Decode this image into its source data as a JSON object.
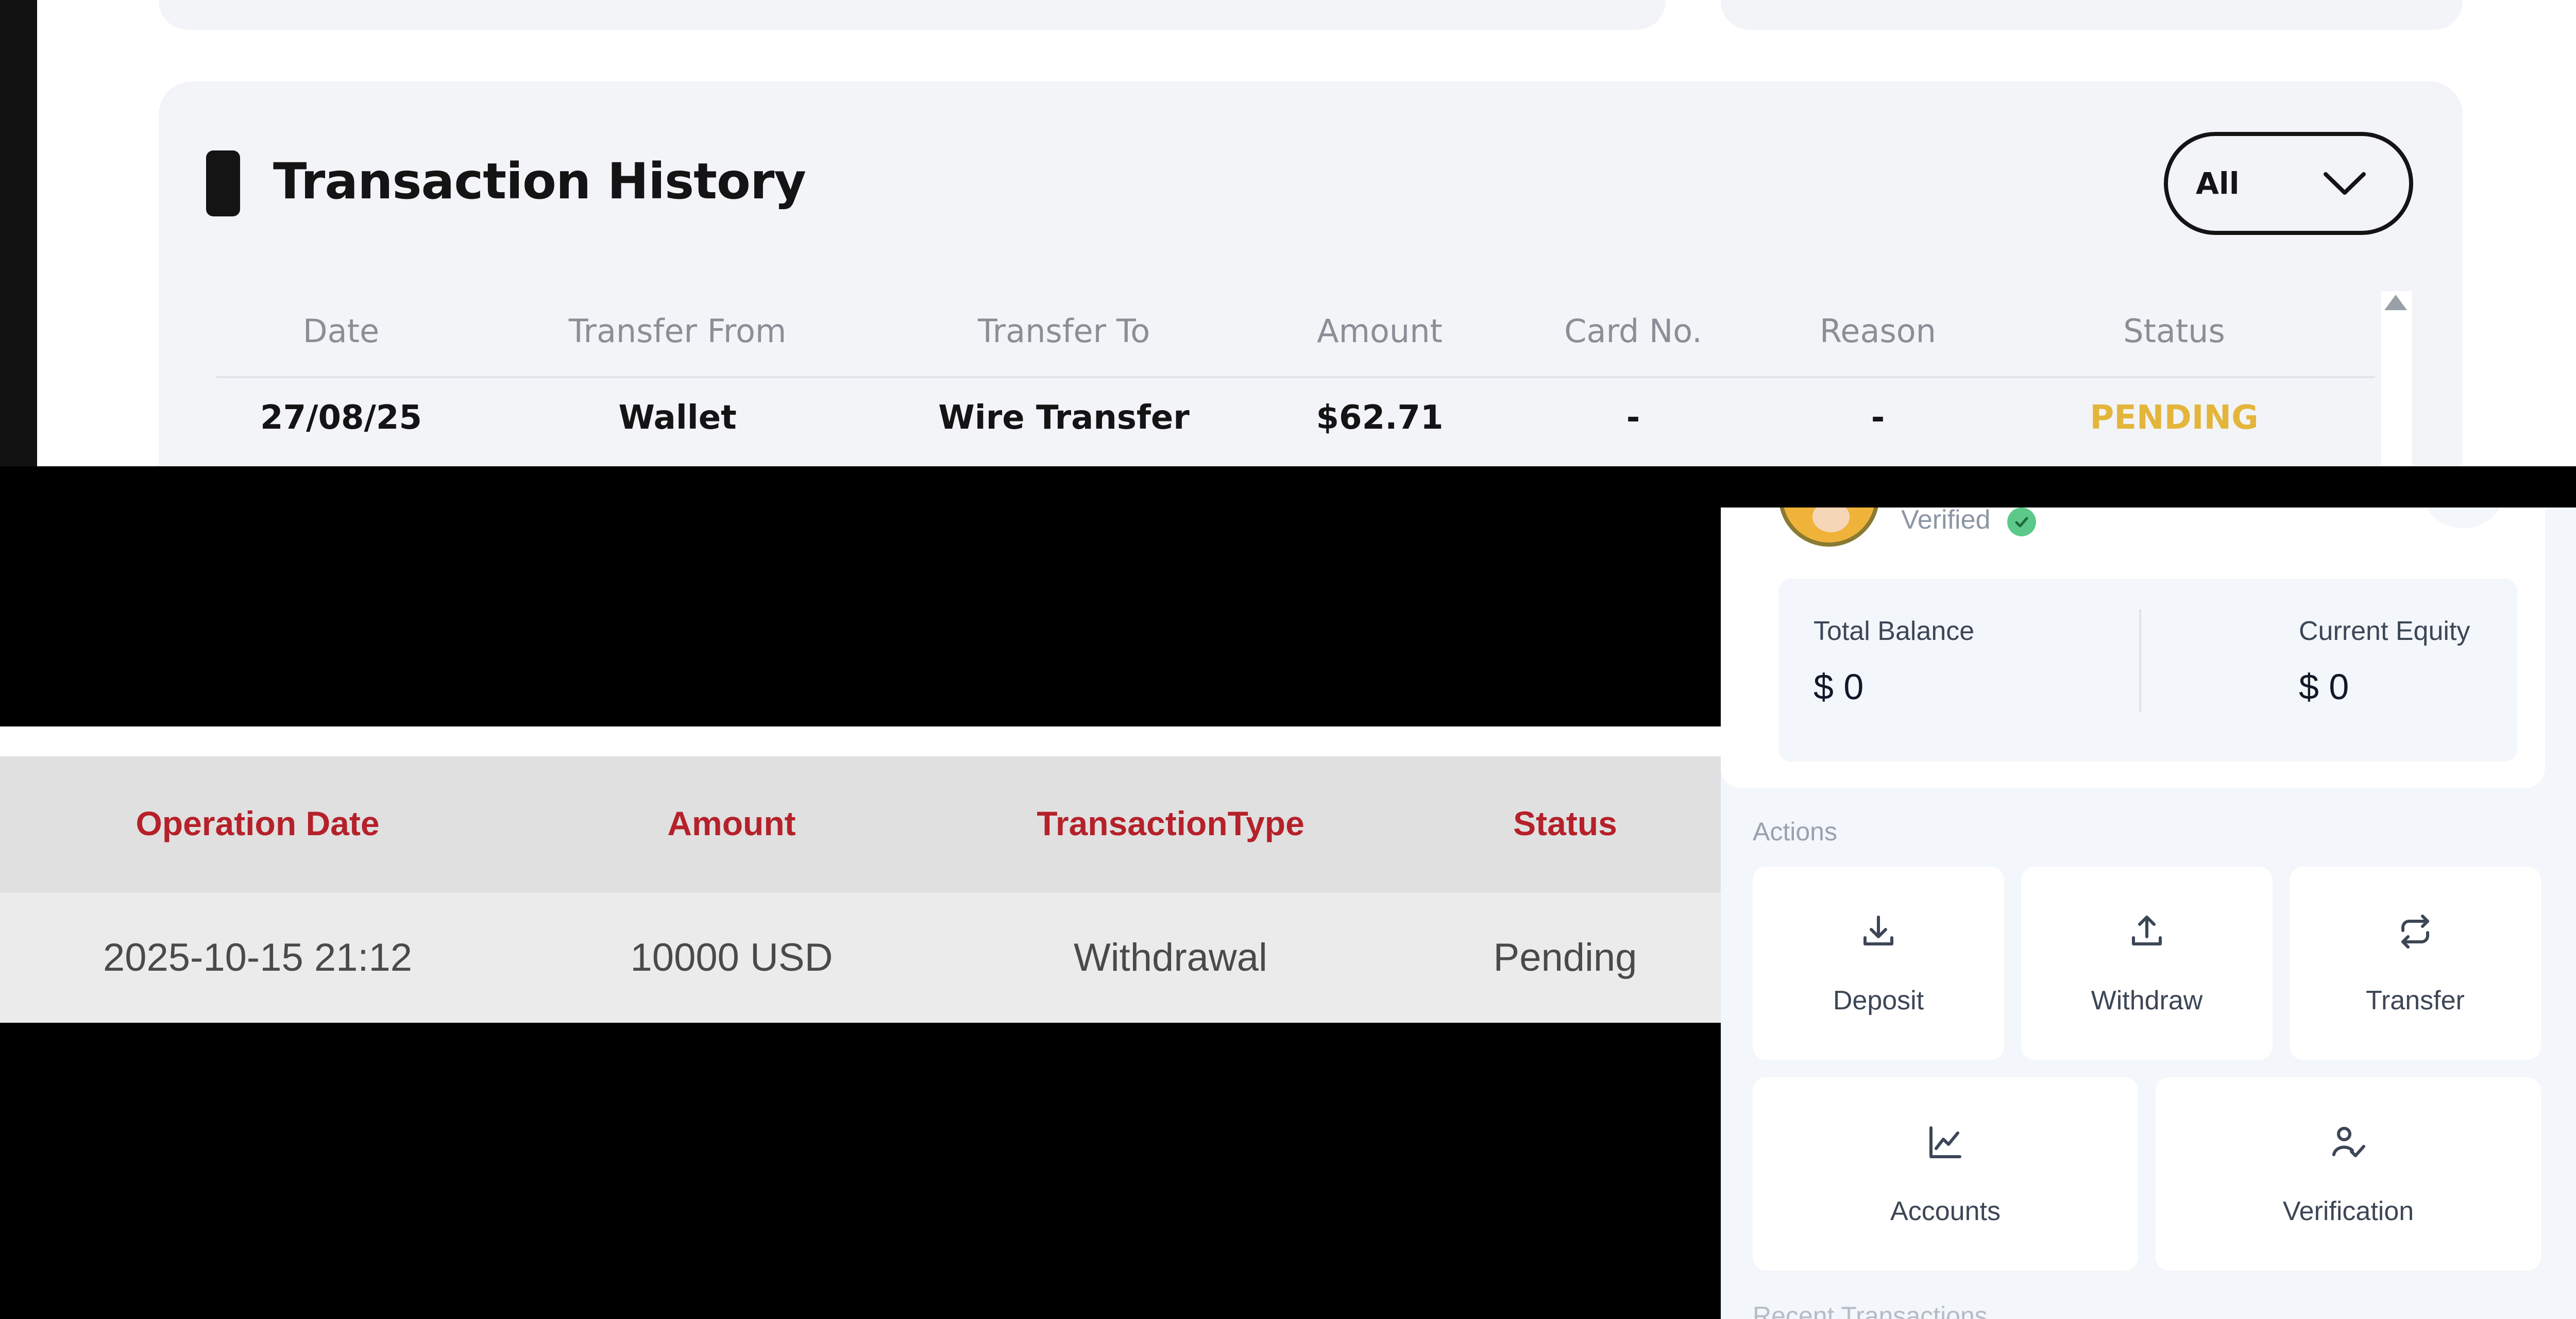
{
  "transaction_history": {
    "title": "Transaction History",
    "filter": {
      "selected": "All"
    },
    "columns": [
      "Date",
      "Transfer From",
      "Transfer To",
      "Amount",
      "Card No.",
      "Reason",
      "Status"
    ],
    "rows": [
      {
        "date": "27/08/25",
        "from": "Wallet",
        "to": "Wire Transfer",
        "amount": "$62.71",
        "card": "-",
        "reason": "-",
        "status": "PENDING"
      }
    ],
    "status_color": "#e3b53b"
  },
  "operations_table": {
    "columns": [
      "Operation Date",
      "Amount",
      "TransactionType",
      "Status"
    ],
    "rows": [
      {
        "date": "2025-10-15 21:12",
        "amount": "10000 USD",
        "type": "Withdrawal",
        "status": "Pending"
      }
    ],
    "header_color": "#b5212a"
  },
  "wallet": {
    "verified_label": "Verified",
    "total_balance_label": "Total Balance",
    "total_balance_value": "$ 0",
    "current_equity_label": "Current Equity",
    "current_equity_value": "$ 0",
    "actions_label": "Actions",
    "actions": [
      {
        "label": "Deposit",
        "icon": "download-icon"
      },
      {
        "label": "Withdraw",
        "icon": "upload-icon"
      },
      {
        "label": "Transfer",
        "icon": "repeat-icon"
      },
      {
        "label": "Accounts",
        "icon": "chart-line-icon"
      },
      {
        "label": "Verification",
        "icon": "user-check-icon"
      }
    ],
    "recent_label": "Recent Transactions"
  }
}
